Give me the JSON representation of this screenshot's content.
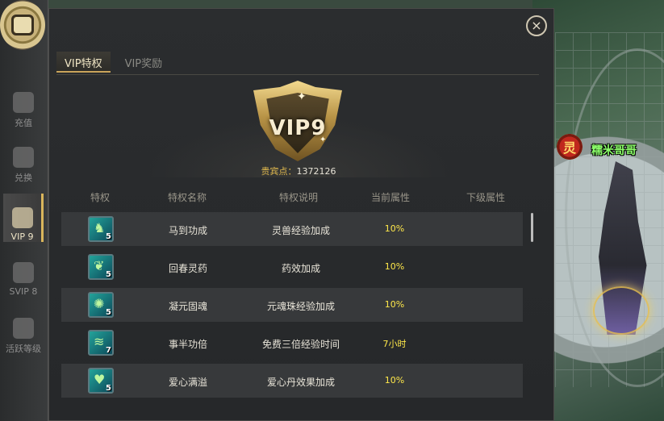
{
  "world": {
    "player_badge": "灵",
    "player_name": "糯米哥哥"
  },
  "nav": {
    "items": [
      {
        "label": "充值",
        "icon": "ingot-icon"
      },
      {
        "label": "兑换",
        "icon": "exchange-icon"
      },
      {
        "label": "VIP 9",
        "icon": "vip-shield-icon"
      },
      {
        "label": "SVIP 8",
        "icon": "svip-badge-icon"
      },
      {
        "label": "活跃等级",
        "icon": "swirl-icon"
      }
    ],
    "active_index": 2
  },
  "panel": {
    "close_label": "×",
    "tabs": [
      {
        "label": "VIP特权"
      },
      {
        "label": "VIP奖励"
      }
    ],
    "active_tab": 0
  },
  "vip": {
    "level": "VIP9",
    "points_label": "贵宾点：",
    "points_value": "1372126"
  },
  "table": {
    "headers": {
      "icon": "特权",
      "name": "特权名称",
      "desc": "特权说明",
      "current": "当前属性",
      "next": "下级属性"
    },
    "rows": [
      {
        "icon": "horse-icon",
        "level": "5",
        "name": "马到功成",
        "desc": "灵兽经验加成",
        "current": "10%",
        "next": ""
      },
      {
        "icon": "herb-icon",
        "level": "5",
        "name": "回春灵药",
        "desc": "药效加成",
        "current": "10%",
        "next": ""
      },
      {
        "icon": "sun-orb-icon",
        "level": "5",
        "name": "凝元固魂",
        "desc": "元魂珠经验加成",
        "current": "10%",
        "next": ""
      },
      {
        "icon": "wind-icon",
        "level": "7",
        "name": "事半功倍",
        "desc": "免费三倍经验时间",
        "current": "7小时",
        "next": ""
      },
      {
        "icon": "heart-potion-icon",
        "level": "5",
        "name": "爱心满溢",
        "desc": "爱心丹效果加成",
        "current": "10%",
        "next": ""
      }
    ]
  }
}
